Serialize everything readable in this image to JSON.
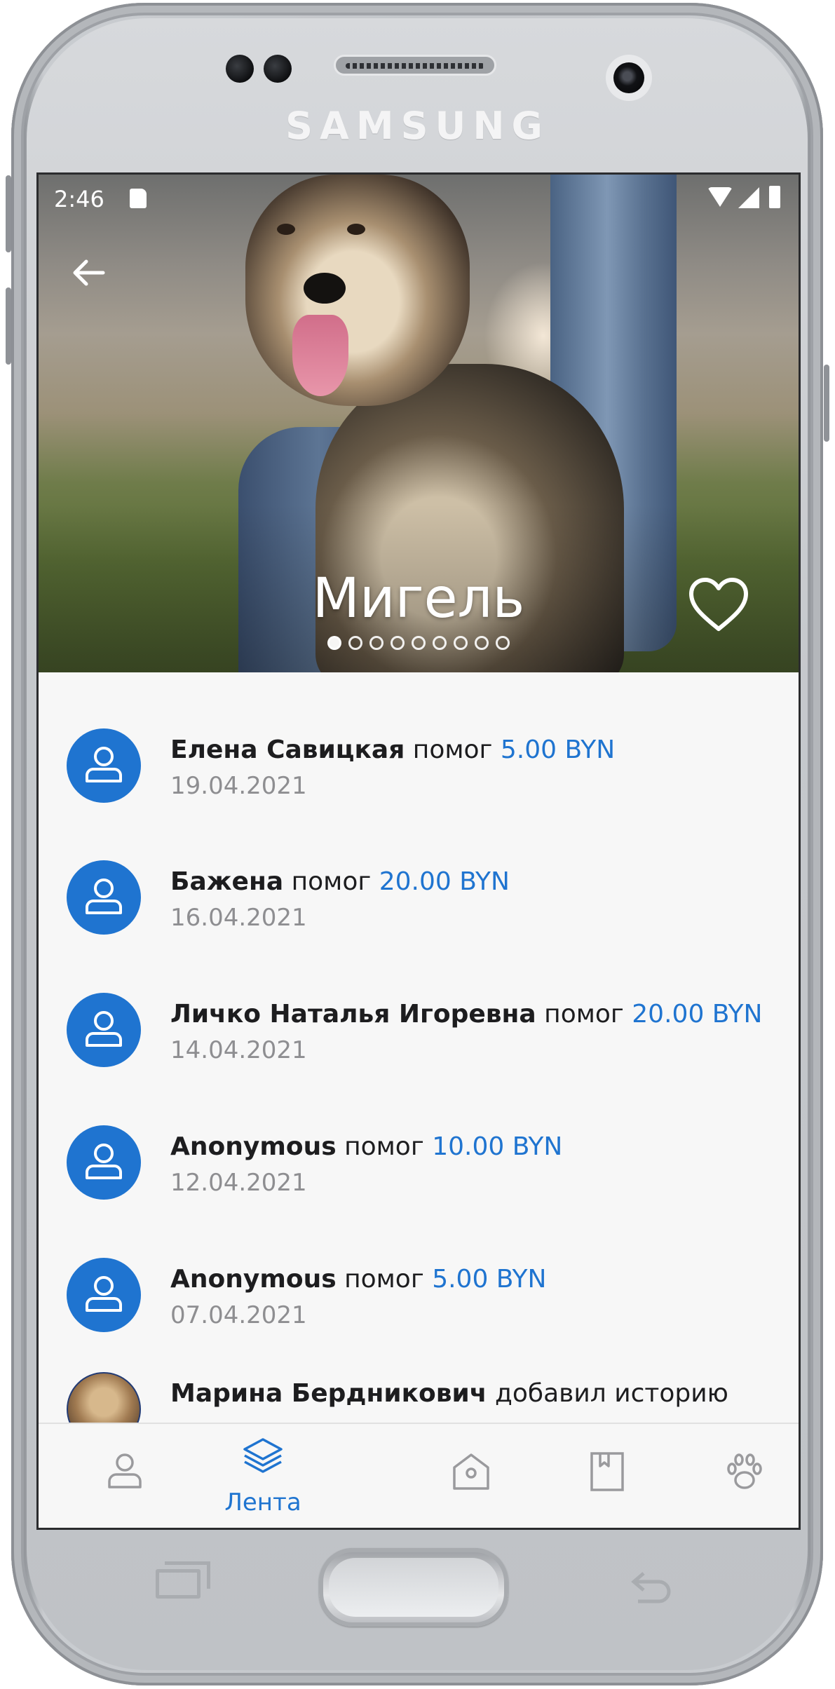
{
  "device": {
    "brand": "SAMSUNG"
  },
  "status_bar": {
    "time": "2:46"
  },
  "pet": {
    "name": "Мигель",
    "photo_count": 9,
    "current_photo": 1
  },
  "feed": {
    "items": [
      {
        "name": "Елена Савицкая",
        "action": "помог",
        "amount": "5.00 BYN",
        "date": "19.04.2021",
        "avatar": "user-icon"
      },
      {
        "name": "Бажена",
        "action": "помог",
        "amount": "20.00 BYN",
        "date": "16.04.2021",
        "avatar": "user-icon"
      },
      {
        "name": "Личко Наталья Игоревна",
        "action": "помог",
        "amount": "20.00 BYN",
        "date": "14.04.2021",
        "avatar": "user-icon"
      },
      {
        "name": "Anonymous",
        "action": "помог",
        "amount": "10.00 BYN",
        "date": "12.04.2021",
        "avatar": "user-icon"
      },
      {
        "name": "Anonymous",
        "action": "помог",
        "amount": "5.00 BYN",
        "date": "07.04.2021",
        "avatar": "user-icon"
      },
      {
        "name": "Марина Бердникович",
        "action": "добавил историю",
        "amount": "",
        "date": "",
        "avatar": "photo"
      }
    ]
  },
  "bottom_nav": {
    "items": [
      {
        "icon": "profile-icon",
        "label": ""
      },
      {
        "icon": "layers-icon",
        "label": "Лента",
        "active": true
      },
      {
        "icon": "shelter-icon",
        "label": ""
      },
      {
        "icon": "book-icon",
        "label": ""
      },
      {
        "icon": "paw-icon",
        "label": ""
      }
    ]
  },
  "colors": {
    "accent": "#1f74d0",
    "text_primary": "#1d1d1f",
    "text_secondary": "#8e8e91",
    "background": "#f7f7f7",
    "icon_inactive": "#9a9a9d"
  }
}
